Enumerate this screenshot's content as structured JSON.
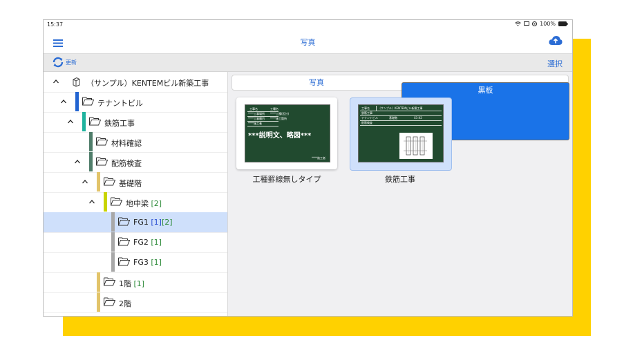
{
  "status_bar": {
    "time": "15:37",
    "battery": "100%"
  },
  "nav": {
    "title": "写真"
  },
  "toolbar": {
    "refresh_label": "更新",
    "select_label": "選択"
  },
  "tree": {
    "items": [
      {
        "label": "（サンプル）KENTEMビル新築工事",
        "count1": "",
        "count2": ""
      },
      {
        "label": "テナントビル",
        "count1": "",
        "count2": ""
      },
      {
        "label": "鉄筋工事",
        "count1": "",
        "count2": ""
      },
      {
        "label": "材料確認",
        "count1": "",
        "count2": ""
      },
      {
        "label": "配筋検査",
        "count1": "",
        "count2": ""
      },
      {
        "label": "基礎階",
        "count1": "",
        "count2": ""
      },
      {
        "label": "地中梁",
        "count1": "[2]",
        "count2": ""
      },
      {
        "label": "FG1",
        "count1": "[1]",
        "count2": "[2]"
      },
      {
        "label": "FG2",
        "count1": "[1]",
        "count2": ""
      },
      {
        "label": "FG3",
        "count1": "[1]",
        "count2": ""
      },
      {
        "label": "1階",
        "count1": "[1]",
        "count2": ""
      },
      {
        "label": "2階",
        "count1": "",
        "count2": ""
      }
    ],
    "level_colors": [
      "#2264d1",
      "#1fb39e",
      "#4f7d6a",
      "#e2c46a",
      "#c9d400",
      "#a8a8a8"
    ]
  },
  "tabs": {
    "photo": "写真",
    "board": "黒板",
    "active": "board"
  },
  "boards": [
    {
      "caption": "工種罫線無しタイプ",
      "f1": "工事名",
      "f2": "工種名",
      "f3": "****工事場所",
      "f4": "****工種(区分)",
      "f5": "****工事種目",
      "f6": "****施工箇所",
      "f7": "****施工者",
      "big": "***説明文、略図***",
      "f8": "****施工者"
    },
    {
      "caption": "鉄筋工事",
      "f1": "工事名",
      "f2": "（サンプル）KENTEMビル新築工事",
      "f3": "鉄筋工事",
      "f4": "テナントビル",
      "f5": "基礎階",
      "f6": "X1-X2",
      "f7": "配筋検査"
    }
  ],
  "colors": {
    "accent": "#1a73e8",
    "board_green": "#214a2f",
    "frame_yellow": "#FFD100",
    "selected_row": "#cfe0fb"
  }
}
